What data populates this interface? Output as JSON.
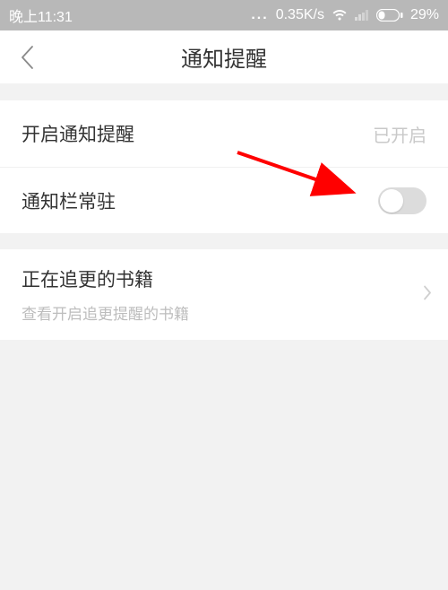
{
  "status": {
    "time": "晚上11:31",
    "speed": "0.35K/s",
    "battery": "29%"
  },
  "header": {
    "title": "通知提醒"
  },
  "rows": {
    "notify": {
      "label": "开启通知提醒",
      "value": "已开启"
    },
    "sticky": {
      "label": "通知栏常驻"
    },
    "books": {
      "label": "正在追更的书籍",
      "sub": "查看开启追更提醒的书籍"
    }
  }
}
